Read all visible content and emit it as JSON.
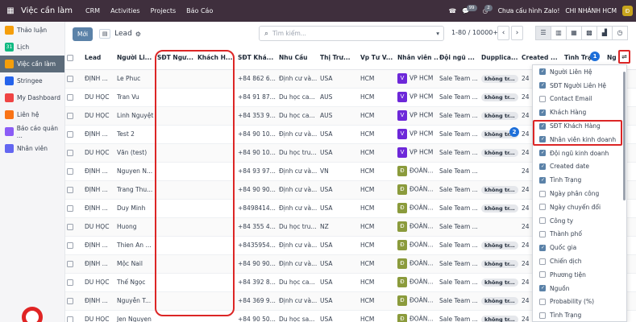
{
  "topbar": {
    "app_title": "Việc cần làm",
    "menu": [
      "CRM",
      "Activities",
      "Projects",
      "Báo Cáo"
    ],
    "chat_count": "99",
    "activity_count": "2",
    "zalo_status": "Chưa cấu hình Zalo!",
    "company": "CHI NHÁNH HCM",
    "company_initial": "Đ"
  },
  "sidebar": {
    "items": [
      {
        "label": "Thảo luận",
        "icon": "chat-icon",
        "color": "#f59e0b"
      },
      {
        "label": "Lịch",
        "icon": "calendar-icon",
        "color": "#10b981",
        "prefix": "31"
      },
      {
        "label": "Việc cần làm",
        "icon": "todo-icon",
        "color": "#f59e0b",
        "active": true
      },
      {
        "label": "Stringee",
        "icon": "stringee-icon",
        "color": "#2563eb"
      },
      {
        "label": "My Dashboard",
        "icon": "dashboard-icon",
        "color": "#ef4444"
      },
      {
        "label": "Liên hệ",
        "icon": "contacts-icon",
        "color": "#f97316"
      },
      {
        "label": "Báo cáo quản ...",
        "icon": "report-icon",
        "color": "#8b5cf6"
      },
      {
        "label": "Nhân viên",
        "icon": "employee-icon",
        "color": "#6366f1"
      }
    ]
  },
  "controlbar": {
    "new_button": "Mới",
    "breadcrumb": "Lead",
    "search_placeholder": "Tìm kiếm...",
    "pager": "1-80 / 10000+",
    "prev": "‹",
    "next": "›"
  },
  "table": {
    "headers": [
      "Lead",
      "Người Li...",
      "SĐT Ngư...",
      "Khách H...",
      "SĐT Khá...",
      "Nhu Cầu",
      "Thị Trư...",
      "Vp Tư V...",
      "Nhân viên ...",
      "Đội ngũ ...",
      "Dupplica...",
      "Created ...",
      "Tình Trạ...",
      "Ng"
    ],
    "rows": [
      {
        "lead": "ĐỊNH ...",
        "contact": "Le Phuc",
        "phone": "+84 862 6...",
        "need": "Định cư và...",
        "market": "USA",
        "office": "HCM",
        "tag": "V",
        "staff": "VP HCM",
        "team": "Sale Team ...",
        "dup": "không tr...",
        "created": "24"
      },
      {
        "lead": "DU HỌC",
        "contact": "Tran Vu",
        "phone": "+84 91 87...",
        "need": "Du học ca...",
        "market": "AUS",
        "office": "HCM",
        "tag": "V",
        "staff": "VP HCM",
        "team": "Sale Team ...",
        "dup": "không tr...",
        "created": "24"
      },
      {
        "lead": "DU HỌC",
        "contact": "Linh Nguyệt",
        "phone": "+84 353 9...",
        "need": "Du học ca...",
        "market": "AUS",
        "office": "HCM",
        "tag": "V",
        "staff": "VP HCM",
        "team": "Sale Team ...",
        "dup": "không tr...",
        "created": "24"
      },
      {
        "lead": "ĐỊNH ...",
        "contact": "Test 2",
        "phone": "+84 90 10...",
        "need": "Định cư và...",
        "market": "USA",
        "office": "HCM",
        "tag": "V",
        "staff": "VP HCM",
        "team": "Sale Team ...",
        "dup": "không tr...",
        "created": "24"
      },
      {
        "lead": "DU HỌC",
        "contact": "Văn (test)",
        "phone": "+84 90 10...",
        "need": "Du học tru...",
        "market": "USA",
        "office": "HCM",
        "tag": "V",
        "staff": "VP HCM",
        "team": "Sale Team ...",
        "dup": "không tr...",
        "created": "24"
      },
      {
        "lead": "ĐỊNH ...",
        "contact": "Nguyen N...",
        "phone": "+84 93 97...",
        "need": "Định cư và...",
        "market": "VN",
        "office": "HCM",
        "tag": "Đ",
        "staff": "ĐOÀN...",
        "team": "Sale Team ...",
        "dup": "",
        "created": "24"
      },
      {
        "lead": "ĐỊNH ...",
        "contact": "Trang Thu...",
        "phone": "+84 90 90...",
        "need": "Định cư và...",
        "market": "USA",
        "office": "HCM",
        "tag": "Đ",
        "staff": "ĐOÀN...",
        "team": "Sale Team ...",
        "dup": "không tr...",
        "created": "24"
      },
      {
        "lead": "ĐỊNH ...",
        "contact": "Duy Minh",
        "phone": "+8498414...",
        "need": "Định cư và...",
        "market": "USA",
        "office": "HCM",
        "tag": "Đ",
        "staff": "ĐOÀN...",
        "team": "Sale Team ...",
        "dup": "không tr...",
        "created": "24"
      },
      {
        "lead": "DU HỌC",
        "contact": "Huong",
        "phone": "+84 355 4...",
        "need": "Du học tru...",
        "market": "NZ",
        "office": "HCM",
        "tag": "Đ",
        "staff": "ĐOÀN...",
        "team": "Sale Team ...",
        "dup": "",
        "created": "24"
      },
      {
        "lead": "ĐỊNH ...",
        "contact": "Thien An ...",
        "phone": "+8435954...",
        "need": "Định cư và...",
        "market": "USA",
        "office": "HCM",
        "tag": "Đ",
        "staff": "ĐOÀN...",
        "team": "Sale Team ...",
        "dup": "không tr...",
        "created": "24"
      },
      {
        "lead": "ĐỊNH ...",
        "contact": "Mộc Nail",
        "phone": "+84 90 90...",
        "need": "Định cư và...",
        "market": "USA",
        "office": "HCM",
        "tag": "Đ",
        "staff": "ĐOÀN...",
        "team": "Sale Team ...",
        "dup": "không tr...",
        "created": "24"
      },
      {
        "lead": "DU HỌC",
        "contact": "Thế Ngọc",
        "phone": "+84 392 8...",
        "need": "Du học ca...",
        "market": "USA",
        "office": "HCM",
        "tag": "Đ",
        "staff": "ĐOÀN...",
        "team": "Sale Team ...",
        "dup": "không tr...",
        "created": "24"
      },
      {
        "lead": "ĐỊNH ...",
        "contact": "Nguyễn T...",
        "phone": "+84 369 9...",
        "need": "Định cư và...",
        "market": "USA",
        "office": "HCM",
        "tag": "Đ",
        "staff": "ĐOÀN...",
        "team": "Sale Team ...",
        "dup": "không tr...",
        "created": "24"
      },
      {
        "lead": "DU HỌC",
        "contact": "Jen Nguyen",
        "phone": "+84 90 50...",
        "need": "Du học sa...",
        "market": "USA",
        "office": "HCM",
        "tag": "Đ",
        "staff": "ĐOÀN...",
        "team": "Sale Team ...",
        "dup": "không tr...",
        "created": "24"
      }
    ]
  },
  "column_menu": {
    "items": [
      {
        "label": "Người Liên Hệ",
        "checked": true
      },
      {
        "label": "SĐT Người Liên Hệ",
        "checked": true
      },
      {
        "label": "Contact Email",
        "checked": false
      },
      {
        "label": "Khách Hàng",
        "checked": true
      },
      {
        "label": "SĐT Khách Hàng",
        "checked": true
      },
      {
        "label": "Nhân viên kinh doanh",
        "checked": true
      },
      {
        "label": "Đội ngũ kinh doanh",
        "checked": true
      },
      {
        "label": "Created date",
        "checked": true
      },
      {
        "label": "Tình Trạng",
        "checked": true
      },
      {
        "label": "Ngày phân công",
        "checked": false
      },
      {
        "label": "Ngày chuyển đổi",
        "checked": false
      },
      {
        "label": "Công ty",
        "checked": false
      },
      {
        "label": "Thành phố",
        "checked": false
      },
      {
        "label": "Quốc gia",
        "checked": true
      },
      {
        "label": "Chiến dịch",
        "checked": false
      },
      {
        "label": "Phương tiện",
        "checked": false
      },
      {
        "label": "Nguồn",
        "checked": true
      },
      {
        "label": "Probability (%)",
        "checked": false
      },
      {
        "label": "Tình Trạng",
        "checked": false
      }
    ]
  },
  "annotations": {
    "badge_1": "1",
    "badge_2": "2"
  },
  "colors": {
    "topbar": "#3f2f3d",
    "accent": "#5b82a8",
    "highlight": "#dc2626",
    "badge": "#1e6fd9"
  }
}
